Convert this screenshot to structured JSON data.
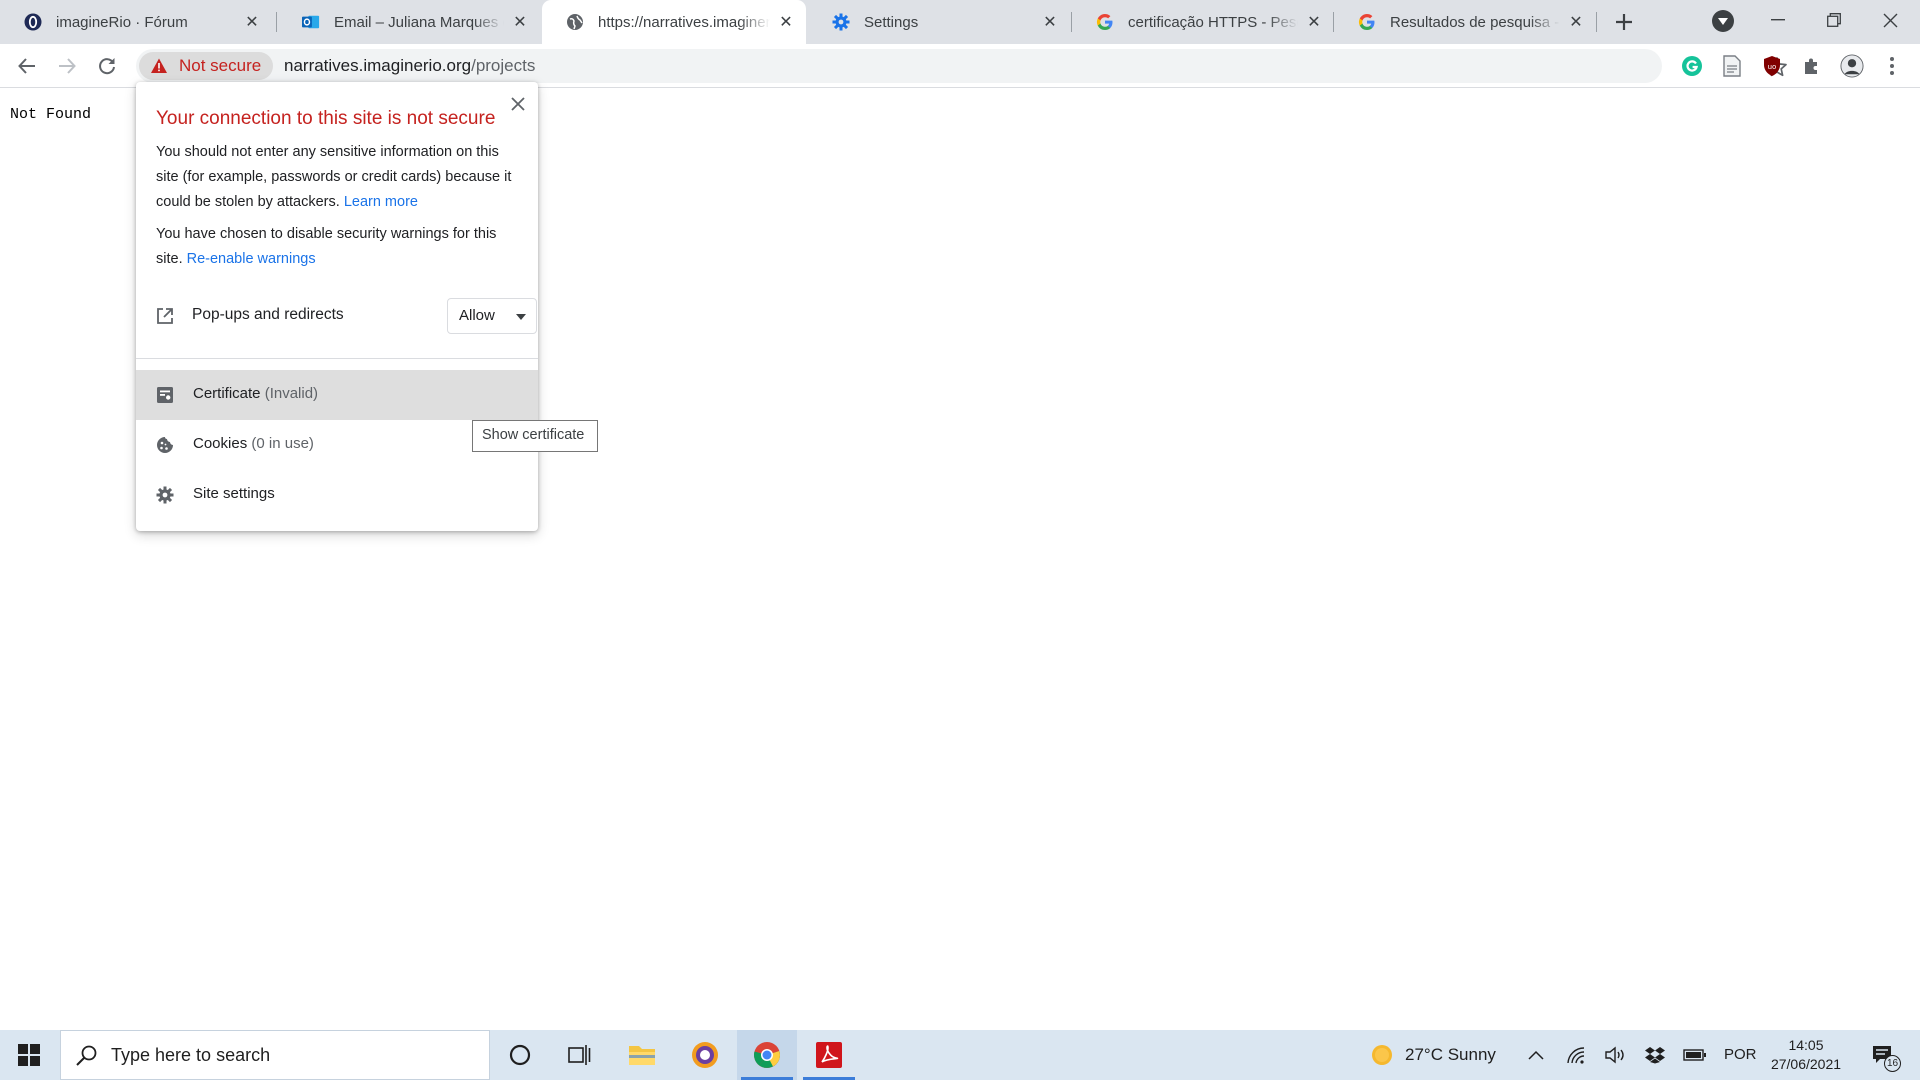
{
  "browser": {
    "tabs": [
      {
        "title": "imagineRio · Fórum",
        "favicon": "opera-o-icon",
        "active": false
      },
      {
        "title": "Email – Juliana Marques da Silva",
        "favicon": "outlook-icon",
        "active": false
      },
      {
        "title": "https://narratives.imaginerio.org/projects",
        "favicon": "globe-icon",
        "active": true
      },
      {
        "title": "Settings",
        "favicon": "gear-icon",
        "active": false
      },
      {
        "title": "certificação HTTPS - Pesquisa Google",
        "favicon": "google-icon",
        "active": false
      },
      {
        "title": "Resultados de pesquisa - Ajuda",
        "favicon": "google-icon",
        "active": false
      }
    ],
    "omnibox": {
      "security_label": "Not secure",
      "url_host": "narratives.imaginerio.org",
      "url_path": "/projects"
    }
  },
  "page": {
    "body_text": "Not Found"
  },
  "page_info": {
    "title": "Your connection to this site is not secure",
    "warning_text": "You should not enter any sensitive information on this site (for example, passwords or credit cards) because it could be stolen by attackers.",
    "learn_more": "Learn more",
    "disabled_text": "You have chosen to disable security warnings for this site.",
    "reenable": "Re-enable warnings",
    "permission": {
      "label": "Pop-ups and redirects",
      "value": "Allow"
    },
    "certificate": {
      "label": "Certificate",
      "status": "(Invalid)"
    },
    "cookies": {
      "label": "Cookies",
      "status": "(0 in use)"
    },
    "site_settings": "Site settings",
    "tooltip": "Show certificate"
  },
  "taskbar": {
    "search_placeholder": "Type here to search",
    "weather": "27°C  Sunny",
    "language": "POR",
    "time": "14:05",
    "date": "27/06/2021",
    "notification_count": "16"
  },
  "colors": {
    "danger": "#c5221f",
    "link": "#1a73e8",
    "tabstrip": "#dee1e6",
    "taskbar": "#dae6f1"
  }
}
